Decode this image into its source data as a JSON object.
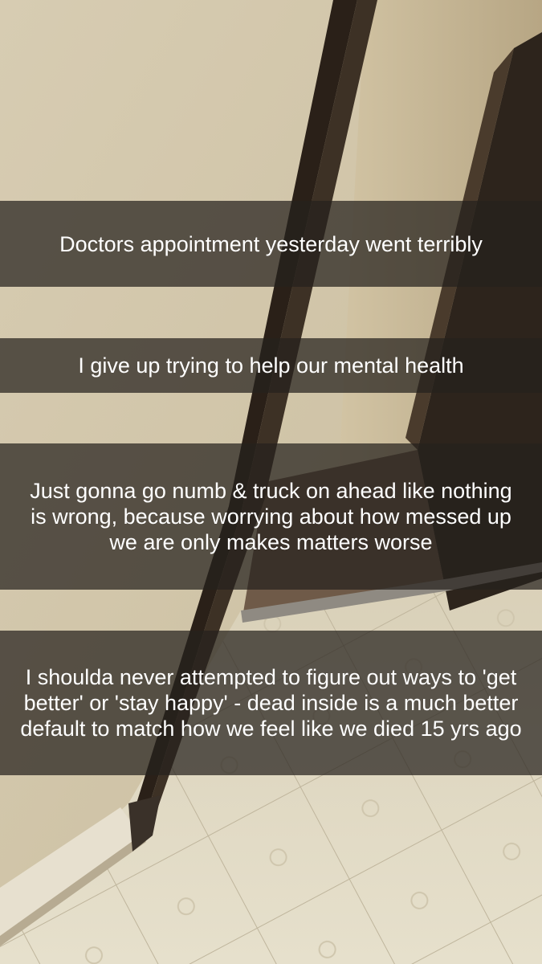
{
  "captions": [
    "Doctors appointment yesterday went terribly",
    "I give up trying to help our mental health",
    "Just gonna go numb & truck on ahead like nothing is wrong, because worrying about how messed up we are only makes matters worse",
    "I shoulda never attempted to figure out ways to 'get better' or 'stay happy' - dead inside is a much better default to match how we feel like we died 15 yrs ago"
  ],
  "colors": {
    "wall": "#d9ccb0",
    "door_frame": "#2a2018",
    "floor": "#e3dcc8",
    "caption_bar": "rgba(38,33,29,0.72)"
  }
}
